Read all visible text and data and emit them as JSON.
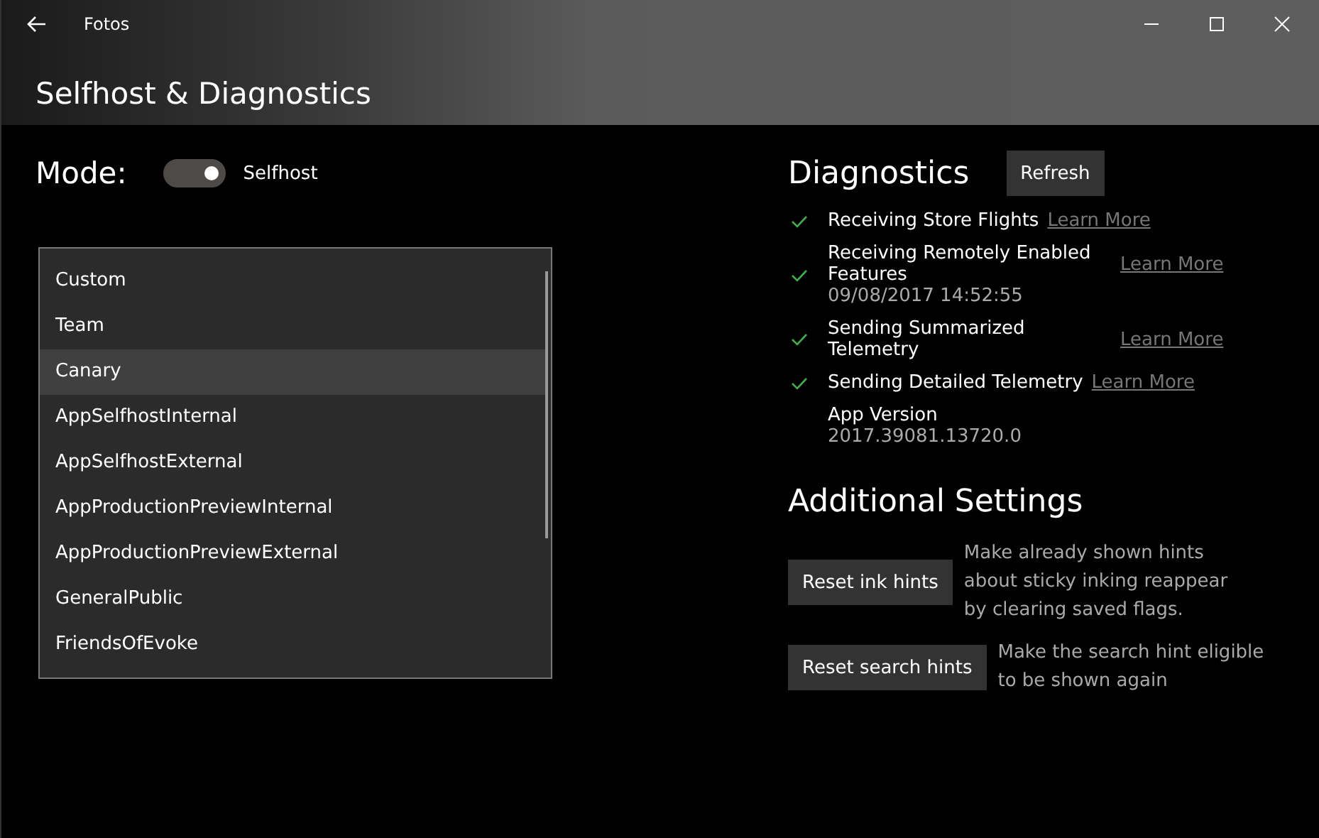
{
  "window": {
    "title": "Fotos"
  },
  "page_title": "Selfhost & Diagnostics",
  "mode": {
    "label": "Mode:",
    "on": true,
    "value": "Selfhost"
  },
  "channels": [
    {
      "label": "Custom",
      "selected": false
    },
    {
      "label": "Team",
      "selected": false
    },
    {
      "label": "Canary",
      "selected": true
    },
    {
      "label": "AppSelfhostInternal",
      "selected": false
    },
    {
      "label": "AppSelfhostExternal",
      "selected": false
    },
    {
      "label": "AppProductionPreviewInternal",
      "selected": false
    },
    {
      "label": "AppProductionPreviewExternal",
      "selected": false
    },
    {
      "label": "GeneralPublic",
      "selected": false
    },
    {
      "label": "FriendsOfEvoke",
      "selected": false
    }
  ],
  "diagnostics": {
    "title": "Diagnostics",
    "refresh_button": "Refresh",
    "items": [
      {
        "label": "Receiving Store Flights",
        "checked": true,
        "link": "Learn More"
      },
      {
        "label": "Receiving Remotely Enabled Features",
        "checked": true,
        "link": "Learn More",
        "timestamp": "09/08/2017 14:52:55"
      },
      {
        "label": "Sending Summarized Telemetry",
        "checked": true,
        "link": "Learn More"
      },
      {
        "label": "Sending Detailed Telemetry",
        "checked": true,
        "link": "Learn More"
      }
    ],
    "app_version": {
      "label": "App Version",
      "value": "2017.39081.13720.0"
    }
  },
  "additional_settings": {
    "title": "Additional Settings",
    "items": [
      {
        "button": "Reset ink hints",
        "description": "Make already shown hints about sticky inking reappear by clearing saved flags."
      },
      {
        "button": "Reset search hints",
        "description": "Make the search hint eligible to be shown again"
      }
    ]
  }
}
